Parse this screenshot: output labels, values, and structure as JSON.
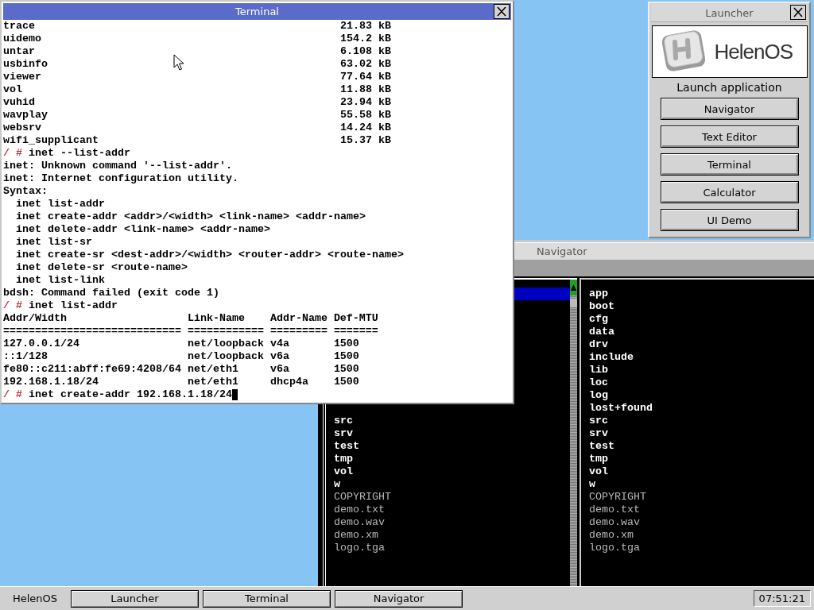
{
  "terminal": {
    "title": "Terminal",
    "lines": [
      {
        "kind": "file",
        "name": "trace",
        "size": "21.83 kB"
      },
      {
        "kind": "file",
        "name": "uidemo",
        "size": "154.2 kB"
      },
      {
        "kind": "file",
        "name": "untar",
        "size": "6.108 kB"
      },
      {
        "kind": "file",
        "name": "usbinfo",
        "size": "63.02 kB"
      },
      {
        "kind": "file",
        "name": "viewer",
        "size": "77.64 kB"
      },
      {
        "kind": "file",
        "name": "vol",
        "size": "11.88 kB"
      },
      {
        "kind": "file",
        "name": "vuhid",
        "size": "23.94 kB"
      },
      {
        "kind": "file",
        "name": "wavplay",
        "size": "55.58 kB"
      },
      {
        "kind": "file",
        "name": "websrv",
        "size": "14.24 kB"
      },
      {
        "kind": "file",
        "name": "wifi_supplicant",
        "size": "15.37 kB"
      },
      {
        "kind": "prompt",
        "prompt": "/ #",
        "command": "inet --list-addr"
      },
      {
        "kind": "text",
        "text": "inet: Unknown command '--list-addr'."
      },
      {
        "kind": "text",
        "text": "inet: Internet configuration utility."
      },
      {
        "kind": "text",
        "text": "Syntax:"
      },
      {
        "kind": "syntax",
        "text": "inet list-addr"
      },
      {
        "kind": "syntax",
        "text": "inet create-addr <addr>/<width> <link-name> <addr-name>"
      },
      {
        "kind": "syntax",
        "text": "inet delete-addr <link-name> <addr-name>"
      },
      {
        "kind": "syntax",
        "text": "inet list-sr"
      },
      {
        "kind": "syntax",
        "text": "inet create-sr <dest-addr>/<width> <router-addr> <route-name>"
      },
      {
        "kind": "syntax",
        "text": "inet delete-sr <route-name>"
      },
      {
        "kind": "syntax",
        "text": "inet list-link"
      },
      {
        "kind": "text",
        "text": "bdsh: Command failed (exit code 1)"
      },
      {
        "kind": "prompt",
        "prompt": "/ #",
        "command": "inet list-addr"
      },
      {
        "kind": "row",
        "cells": [
          "Addr/Width",
          "Link-Name",
          "Addr-Name",
          "Def-MTU"
        ]
      },
      {
        "kind": "row",
        "cells": [
          "============================",
          "============",
          "=========",
          "======="
        ]
      },
      {
        "kind": "row",
        "cells": [
          "127.0.0.1/24",
          "net/loopback",
          "v4a",
          "1500"
        ]
      },
      {
        "kind": "row",
        "cells": [
          "::1/128",
          "net/loopback",
          "v6a",
          "1500"
        ]
      },
      {
        "kind": "row",
        "cells": [
          "fe80::c211:abff:fe69:4208/64",
          "net/eth1",
          "v6a",
          "1500"
        ]
      },
      {
        "kind": "row",
        "cells": [
          "192.168.1.18/24",
          "net/eth1",
          "dhcp4a",
          "1500"
        ]
      },
      {
        "kind": "prompt",
        "prompt": "/ #",
        "command": "inet create-addr 192.168.1.18/24",
        "cursor": true
      }
    ]
  },
  "launcher": {
    "title": "Launcher",
    "logo_text": "HelenOS",
    "heading": "Launch application",
    "buttons": [
      "Navigator",
      "Text Editor",
      "Terminal",
      "Calculator",
      "UI Demo"
    ]
  },
  "navigator": {
    "title": "Navigator",
    "left_panel": {
      "items": [
        {
          "name": "src",
          "kind": "dir"
        },
        {
          "name": "srv",
          "kind": "dir"
        },
        {
          "name": "test",
          "kind": "dir"
        },
        {
          "name": "tmp",
          "kind": "dir"
        },
        {
          "name": "vol",
          "kind": "dir"
        },
        {
          "name": "w",
          "kind": "dir"
        },
        {
          "name": "COPYRIGHT",
          "kind": "file"
        },
        {
          "name": "demo.txt",
          "kind": "file"
        },
        {
          "name": "demo.wav",
          "kind": "file"
        },
        {
          "name": "demo.xm",
          "kind": "file"
        },
        {
          "name": "logo.tga",
          "kind": "file"
        }
      ]
    },
    "right_panel": {
      "items": [
        {
          "name": "app",
          "kind": "dir"
        },
        {
          "name": "boot",
          "kind": "dir"
        },
        {
          "name": "cfg",
          "kind": "dir"
        },
        {
          "name": "data",
          "kind": "dir"
        },
        {
          "name": "drv",
          "kind": "dir"
        },
        {
          "name": "include",
          "kind": "dir"
        },
        {
          "name": "lib",
          "kind": "dir"
        },
        {
          "name": "loc",
          "kind": "dir"
        },
        {
          "name": "log",
          "kind": "dir"
        },
        {
          "name": "lost+found",
          "kind": "dir"
        },
        {
          "name": "src",
          "kind": "dir"
        },
        {
          "name": "srv",
          "kind": "dir"
        },
        {
          "name": "test",
          "kind": "dir"
        },
        {
          "name": "tmp",
          "kind": "dir"
        },
        {
          "name": "vol",
          "kind": "dir"
        },
        {
          "name": "w",
          "kind": "dir"
        },
        {
          "name": "COPYRIGHT",
          "kind": "file"
        },
        {
          "name": "demo.txt",
          "kind": "file"
        },
        {
          "name": "demo.wav",
          "kind": "file"
        },
        {
          "name": "demo.xm",
          "kind": "file"
        },
        {
          "name": "logo.tga",
          "kind": "file"
        }
      ]
    }
  },
  "taskbar": {
    "label": "HelenOS",
    "buttons": [
      {
        "label": "Launcher"
      },
      {
        "label": "Terminal"
      },
      {
        "label": "Navigator"
      }
    ],
    "clock": "07:51:21"
  }
}
